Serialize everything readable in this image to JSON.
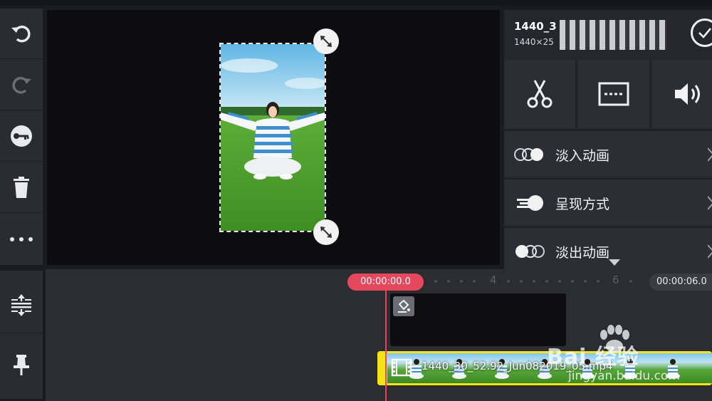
{
  "preview": {
    "clip_label": "photo"
  },
  "panel": {
    "title": "1440_3",
    "subtitle": "1440×25",
    "tools": [
      {
        "icon": "scissors-icon"
      },
      {
        "icon": "subtitle-icon"
      },
      {
        "icon": "volume-icon"
      }
    ],
    "animations": [
      {
        "label": "淡入动画",
        "icon": "fade-in-icon"
      },
      {
        "label": "呈现方式",
        "icon": "presentation-icon"
      },
      {
        "label": "淡出动画",
        "icon": "fade-out-icon"
      }
    ]
  },
  "timeline": {
    "current_time": "00:00:00.0",
    "duration": "00:00:06.0",
    "tick_labels": [
      "4",
      "6"
    ],
    "clip_filename": "1440_30_52.92_Jun082019_05.mp4"
  },
  "watermark": {
    "main": "Bai 经验",
    "sub": "jingyan.baidu.com"
  },
  "colors": {
    "accent": "#e5475d",
    "clip": "#f5e21b"
  }
}
